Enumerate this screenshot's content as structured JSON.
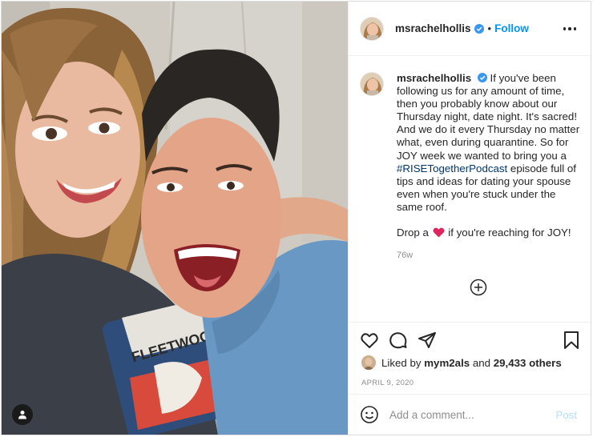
{
  "post": {
    "username": "msrachelhollis",
    "follow_label": "Follow",
    "separator": "•",
    "caption_parts": {
      "line1_pre": "If you've been following us for any amount of time, then you probably know about our Thursday night, date night. It's sacred! And we do it every Thursday no matter what, even during quarantine. So for JOY week we wanted to bring you a ",
      "hashtag": "#RISETogetherPodcast",
      "line1_post": " episode full of tips and ideas for dating your spouse even when you're stuck under the same roof.",
      "line2_pre": "Drop a ",
      "line2_post": " if you're reaching for JOY!"
    },
    "time_ago": "76w",
    "likes": {
      "prefix": "Liked by ",
      "user": "mym2als",
      "middle": " and ",
      "count": "29,433 others"
    },
    "date": "APRIL 9, 2020",
    "comment_placeholder": "Add a comment...",
    "post_label": "Post"
  },
  "icons": {
    "verified": "verified-badge-icon",
    "more": "more-options-icon",
    "like": "heart-outline-icon",
    "comment": "comment-bubble-icon",
    "share": "paper-plane-icon",
    "save": "bookmark-icon",
    "add": "plus-circle-icon",
    "emoji": "smiley-icon",
    "tag": "user-tag-icon"
  },
  "colors": {
    "link_blue": "#0095f6",
    "hashtag": "#00376b",
    "muted": "#8e8e8e",
    "heart_red": "#e0245e",
    "post_disabled": "#b2dffc"
  }
}
